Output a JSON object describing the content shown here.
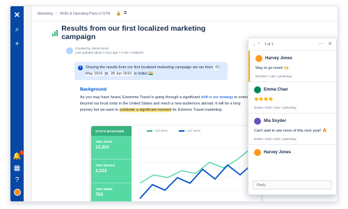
{
  "topbar": {
    "breadcrumb": [
      "Marketing",
      "OKRs & Operating Plans in GTM"
    ],
    "share_label": "Share"
  },
  "page": {
    "title": "Results from our first localized marketing campaign",
    "author_line": "Created by Jamie Gevrs",
    "updated_line": "Last updated about 1 hour ago • 4 min • Analytics",
    "info_before": "Sharing the results from our first localized marketing campaign we ran from",
    "info_date1": "01 May 2019",
    "info_to": "to",
    "info_date2": "28 Jun 2019",
    "info_after": "in India! 🇮🇳",
    "background_heading": "Background",
    "para_a": "As you may have heard, Exetreme Travel is going through a significant",
    "para_link": "shift in our strategy",
    "para_b": "to extend beyond our local roots in the United States and reach a new audiences abroad. It will be a long journey but",
    "para_c": "we want to",
    "para_hl": "celebrate a significant moment",
    "para_d": "for Extreme Travel marketing."
  },
  "dashboard": {
    "header": "STATS MANAGER",
    "legend_this": "THIS WEEK",
    "legend_last": "LAST WEEK",
    "stats": [
      {
        "label": "THIS YEAR",
        "value": "12,321"
      },
      {
        "label": "THIS MONTH",
        "value": "2,123"
      },
      {
        "label": "THIS WEEK",
        "value": "753"
      }
    ],
    "colors": {
      "this_week": "#36b37e",
      "last_week": "#0052cc"
    }
  },
  "comments": {
    "counter": "1 of 1",
    "items": [
      {
        "author": "Harvey Jones",
        "text": "Way to go team! 🙌",
        "actions": "Resolve • Like • yesterday",
        "avatar_color": "#ff991f"
      },
      {
        "author": "Emma Chan",
        "text": "👏👏👏👏",
        "actions": "Delete • Edit • Like • yesterday",
        "avatar_color": "#00875a"
      },
      {
        "author": "Mia Snyder",
        "text": "Can't wait to see more of this next year! 🔥",
        "actions": "Delete • Edit • Like • yesterday",
        "avatar_color": "#6554c0"
      },
      {
        "author": "Harvey Jones",
        "text": "",
        "actions": "",
        "avatar_color": "#ff991f"
      }
    ],
    "reply_placeholder": "Reply"
  }
}
